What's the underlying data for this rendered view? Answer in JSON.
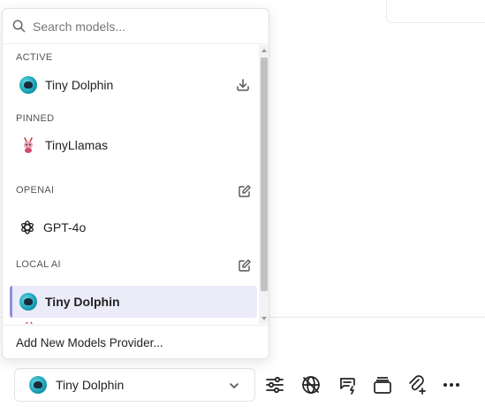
{
  "dropdown": {
    "search_placeholder": "Search models...",
    "sections": {
      "active": {
        "label": "ACTIVE",
        "model": "Tiny Dolphin"
      },
      "pinned": {
        "label": "PINNED",
        "model": "TinyLlamas"
      },
      "openai": {
        "label": "OPENAI",
        "model": "GPT-4o"
      },
      "local_ai": {
        "label": "LOCAL AI",
        "model": "Tiny Dolphin"
      }
    },
    "add_provider": "Add New Models Provider..."
  },
  "bottom_bar": {
    "selected_model": "Tiny Dolphin",
    "tools": [
      "sliders-icon",
      "globe-off-icon",
      "message-bolt-icon",
      "folder-icon",
      "paperclip-plus-icon",
      "more-icon"
    ]
  },
  "colors": {
    "selected_bg": "#ebebfa",
    "selected_accent": "#8f8fdc",
    "scrollbar_thumb": "#c1c1c1"
  }
}
